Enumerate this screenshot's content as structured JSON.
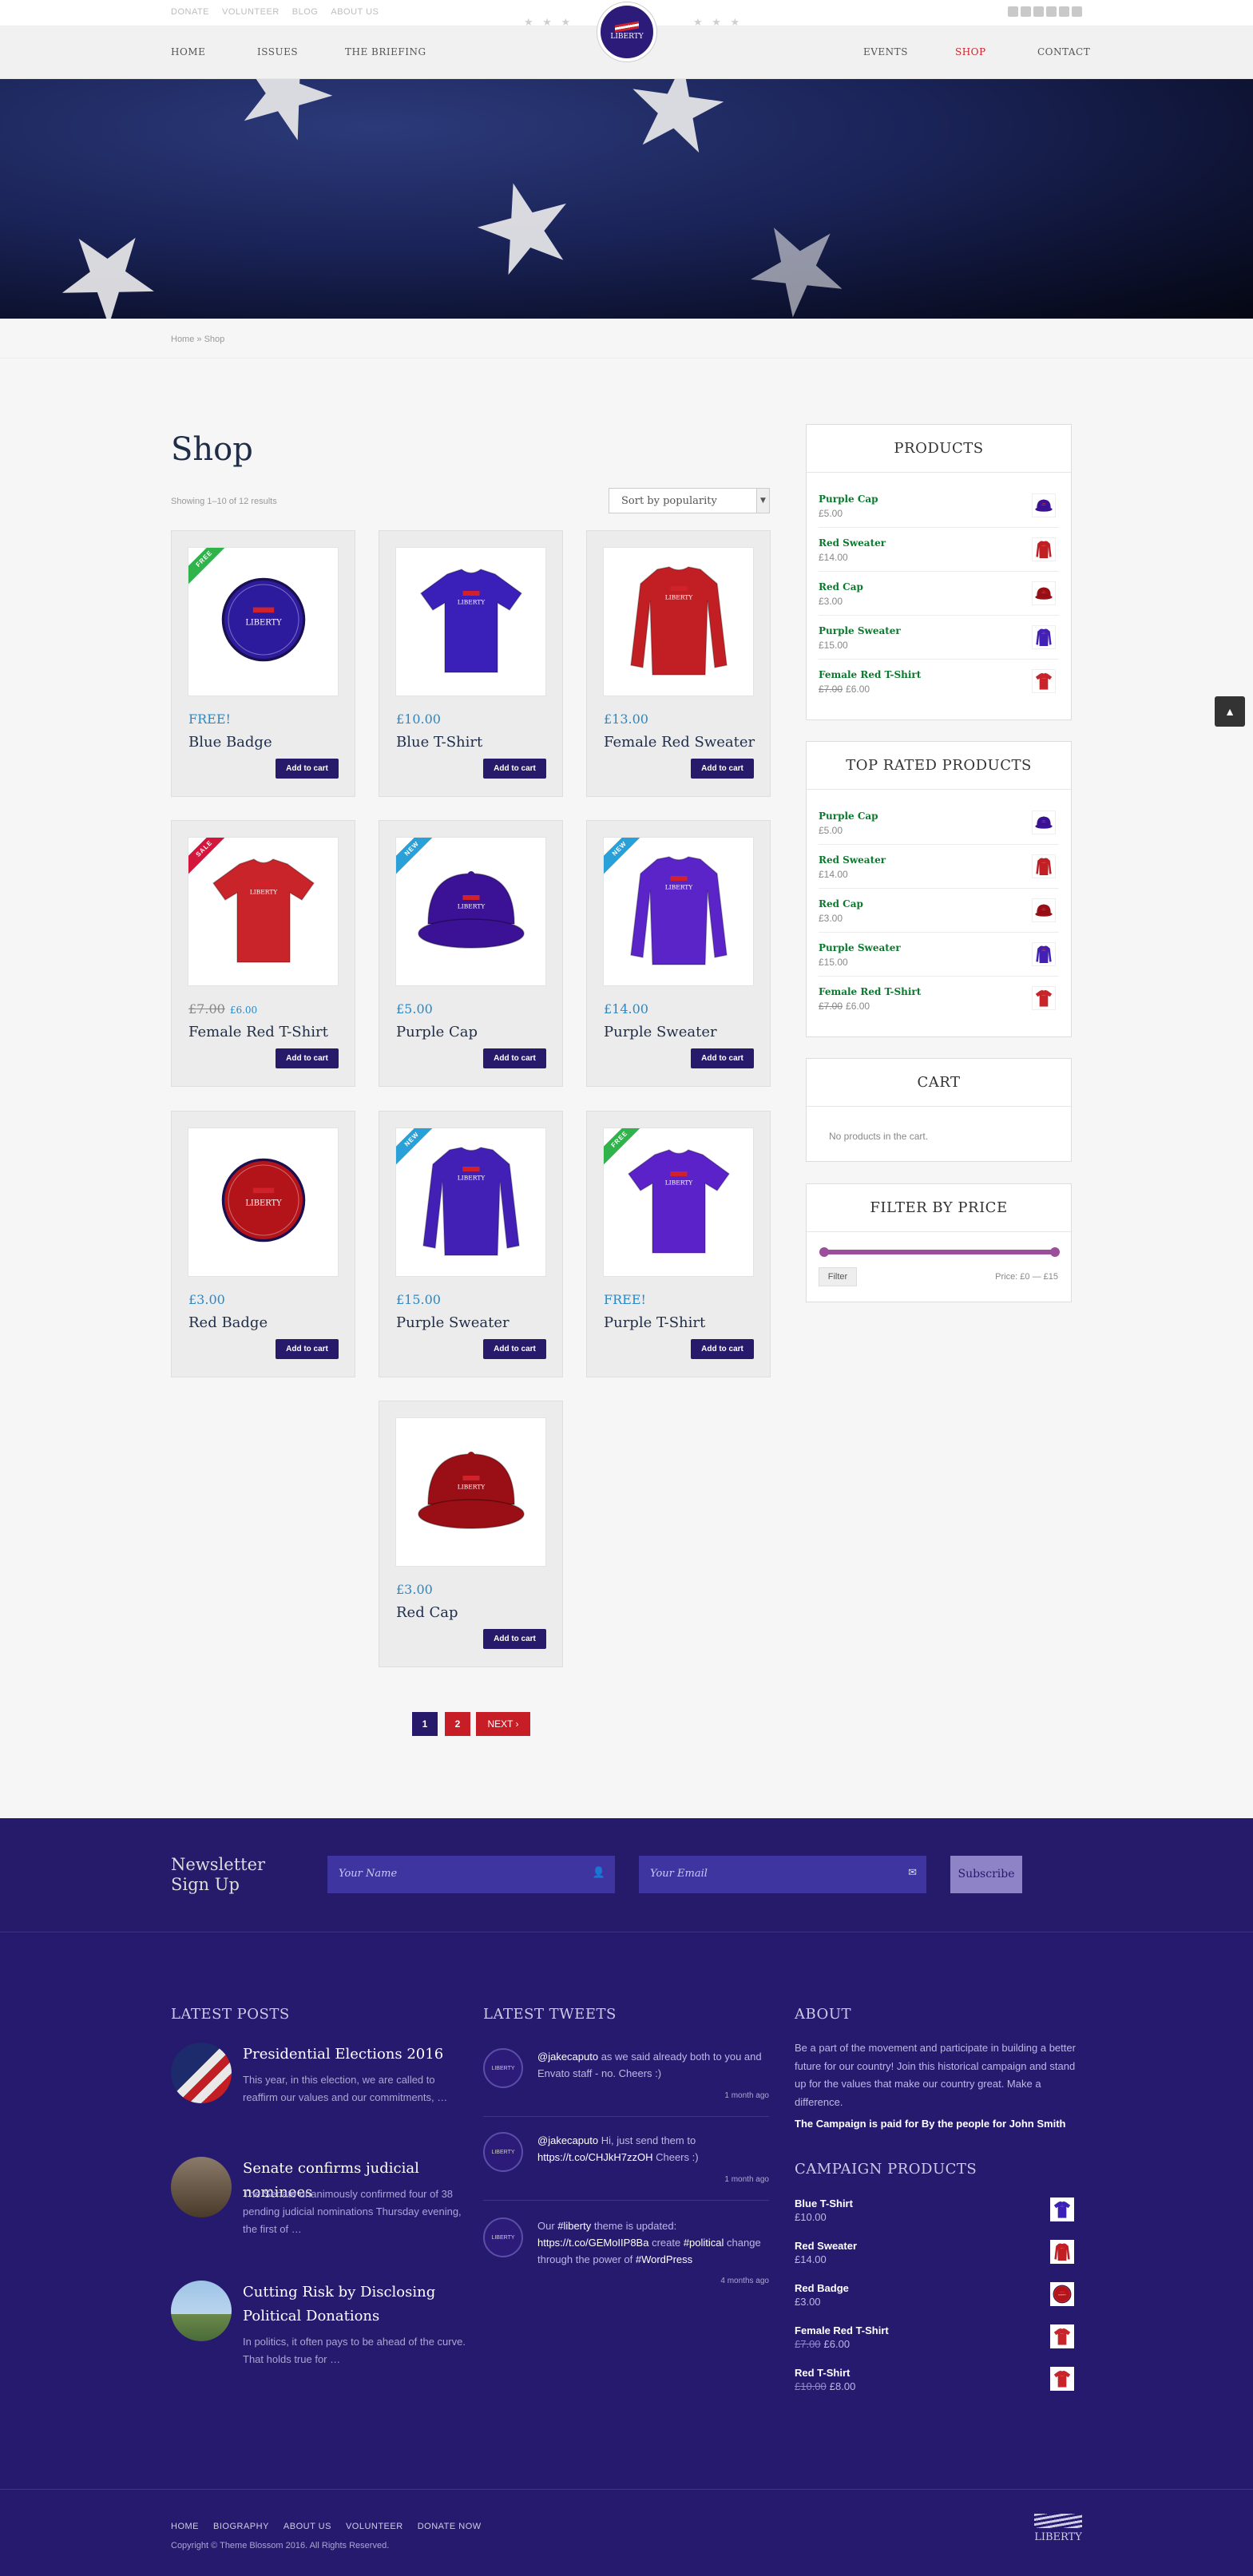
{
  "topbar": {
    "links": [
      "DONATE",
      "VOLUNTEER",
      "BLOG",
      "ABOUT US"
    ]
  },
  "nav": {
    "left": [
      "HOME",
      "ISSUES",
      "THE BRIEFING"
    ],
    "right": [
      "EVENTS",
      "SHOP",
      "CONTACT"
    ],
    "logo_text": "LIBERTY",
    "stars": "★ ★ ★"
  },
  "breadcrumb": "Home » Shop",
  "shop": {
    "title": "Shop",
    "showing": "Showing 1–10 of 12 results",
    "sort": "Sort by popularity",
    "add_to_cart": "Add to cart",
    "products": [
      {
        "name": "Blue Badge",
        "price": "FREE!",
        "badge": "FREE",
        "badge_color": "#2fb34a",
        "kind": "badge",
        "color": "#2d1b9e"
      },
      {
        "name": "Blue T-Shirt",
        "price": "£10.00",
        "badge": "",
        "kind": "tshirt",
        "color": "#3a1fb8"
      },
      {
        "name": "Female Red Sweater",
        "price": "£13.00",
        "badge": "",
        "kind": "sweater",
        "color": "#c21f25"
      },
      {
        "name": "Female Red T-Shirt",
        "old_price": "£7.00",
        "price": "£6.00",
        "badge": "SALE",
        "badge_color": "#d4163c",
        "kind": "tshirt",
        "color": "#c8242a"
      },
      {
        "name": "Purple Cap",
        "price": "£5.00",
        "badge": "NEW",
        "badge_color": "#2aa0d8",
        "kind": "cap",
        "color": "#3b1296"
      },
      {
        "name": "Purple Sweater",
        "price": "£14.00",
        "badge": "NEW",
        "badge_color": "#2aa0d8",
        "kind": "sweater",
        "color": "#5a24c8"
      },
      {
        "name": "Red Badge",
        "price": "£3.00",
        "badge": "",
        "kind": "badge",
        "color": "#b3141a"
      },
      {
        "name": "Purple Sweater",
        "price": "£15.00",
        "badge": "NEW",
        "badge_color": "#2aa0d8",
        "kind": "sweater",
        "color": "#4320b5"
      },
      {
        "name": "Purple T-Shirt",
        "price": "FREE!",
        "badge": "FREE",
        "badge_color": "#2fb34a",
        "kind": "tshirt",
        "color": "#5b22c9"
      },
      {
        "name": "Red Cap",
        "price": "£3.00",
        "badge": "",
        "kind": "cap",
        "color": "#9a0f16"
      }
    ],
    "pagination": [
      "1",
      "2",
      "NEXT ›"
    ]
  },
  "sidebar": {
    "products_title": "PRODUCTS",
    "top_rated_title": "TOP RATED PRODUCTS",
    "items": [
      {
        "name": "Purple Cap",
        "price": "£5.00",
        "color": "#3b1296"
      },
      {
        "name": "Red Sweater",
        "price": "£14.00",
        "color": "#c21f25"
      },
      {
        "name": "Red Cap",
        "price": "£3.00",
        "color": "#9a0f16"
      },
      {
        "name": "Purple Sweater",
        "price": "£15.00",
        "color": "#4320b5"
      },
      {
        "name": "Female Red T-Shirt",
        "old_price": "£7.00",
        "price": "£6.00",
        "color": "#c8242a"
      }
    ],
    "cart_title": "CART",
    "cart_empty": "No products in the cart.",
    "filter_title": "FILTER BY PRICE",
    "filter_button": "Filter",
    "price_range": "Price: £0 — £15",
    "slider_color": "#9b4f9b"
  },
  "newsletter": {
    "title_1": "Newsletter",
    "title_2": "Sign Up",
    "name_placeholder": "Your Name",
    "email_placeholder": "Your Email",
    "button": "Subscribe"
  },
  "footer": {
    "latest_posts_title": "LATEST POSTS",
    "posts": [
      {
        "title": "Presidential Elections 2016",
        "excerpt": "This year, in this election, we are called to reaffirm our values and our commitments, …"
      },
      {
        "title": "Senate confirms judicial nominees",
        "excerpt": "The Senate unanimously confirmed four of 38 pending judicial nominations Thursday evening, the first of …"
      },
      {
        "title": "Cutting Risk by Disclosing Political Donations",
        "excerpt": "In politics, it often pays to be ahead of the curve. That holds true for …"
      }
    ],
    "tweets_title": "LATEST TWEETS",
    "tweets": [
      {
        "user": "@jakecaputo",
        "text": " as we said already both to you and Envato staff - no. Cheers :)",
        "time": "1 month ago"
      },
      {
        "user": "@jakecaputo",
        "text": " Hi, just send them to ",
        "link": "https://t.co/CHJkH7zzOH",
        "tail": " Cheers :)",
        "time": "1 month ago"
      },
      {
        "pre": "Our ",
        "tag1": "#liberty",
        "mid": " theme is updated: ",
        "link": "https://t.co/GEMoIIP8Ba",
        "mid2": " create ",
        "tag2": "#political",
        "mid3": " change through the power of ",
        "tag3": "#WordPress",
        "time": "4 months ago"
      }
    ],
    "about_title": "ABOUT",
    "about_text": "Be a part of the movement and participate in building a better future for our country! Join this historical campaign and stand up for the values that make our country great. Make a difference.",
    "paid_by": "The Campaign is paid for By the people for John Smith",
    "campaign_title": "CAMPAIGN PRODUCTS",
    "campaign": [
      {
        "name": "Blue T-Shirt",
        "price": "£10.00",
        "color": "#3a1fb8"
      },
      {
        "name": "Red Sweater",
        "price": "£14.00",
        "color": "#c21f25"
      },
      {
        "name": "Red Badge",
        "price": "£3.00",
        "color": "#b3141a"
      },
      {
        "name": "Female Red T-Shirt",
        "old_price": "£7.00",
        "price": "£6.00",
        "color": "#c8242a"
      },
      {
        "name": "Red T-Shirt",
        "old_price": "£10.00",
        "price": "£8.00",
        "color": "#c8242a"
      }
    ],
    "bottom_links": [
      "HOME",
      "BIOGRAPHY",
      "ABOUT US",
      "VOLUNTEER",
      "DONATE NOW"
    ],
    "copyright": "Copyright © Theme Blossom 2016. All Rights Reserved.",
    "logo_text": "LIBERTY"
  },
  "colors": {
    "accent": "#271a6a",
    "price_blue": "#2c88c5",
    "nav_active": "#d1212a",
    "footer_bg": "#251a6d"
  }
}
